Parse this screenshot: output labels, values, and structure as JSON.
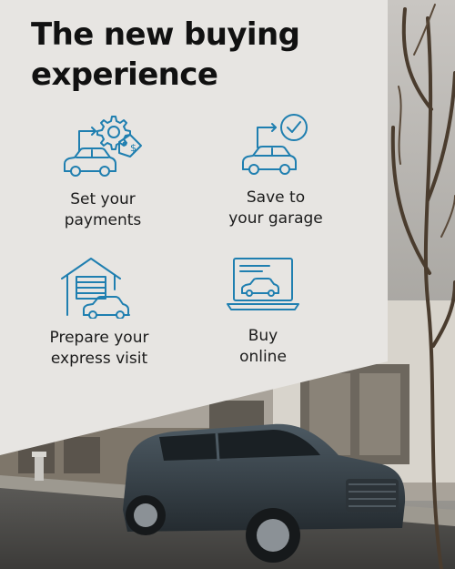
{
  "headline": "The new buying experience",
  "features": [
    {
      "icon": "payment-car-gear-icon",
      "line1": "Set your",
      "line2": "payments"
    },
    {
      "icon": "garage-checkmark-icon",
      "line1": "Save to",
      "line2": "your garage"
    },
    {
      "icon": "garage-express-icon",
      "line1": "Prepare your",
      "line2": "express visit"
    },
    {
      "icon": "laptop-car-icon",
      "line1": "Buy",
      "line2": "online"
    }
  ],
  "colors": {
    "panel": "#e7e5e2",
    "icon_stroke": "#1f7fb0",
    "text": "#111111"
  }
}
